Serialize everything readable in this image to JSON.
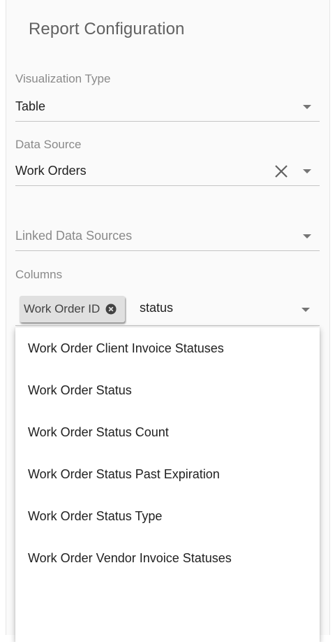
{
  "title": "Report Configuration",
  "visualization": {
    "label": "Visualization Type",
    "value": "Table"
  },
  "data_source": {
    "label": "Data Source",
    "value": "Work Orders"
  },
  "linked_sources": {
    "placeholder": "Linked Data Sources"
  },
  "columns": {
    "label": "Columns",
    "chips": [
      "Work Order ID"
    ],
    "search_value": "status"
  },
  "menu": {
    "items": [
      "Work Order Client Invoice Statuses",
      "Work Order Status",
      "Work Order Status Count",
      "Work Order Status Past Expiration",
      "Work Order Status Type",
      "Work Order Vendor Invoice Statuses"
    ]
  },
  "icons": {
    "dropdown": "caret-down-icon",
    "clear": "close-icon",
    "chip_remove": "cancel-circle-icon"
  },
  "colors": {
    "text_primary": "#212121",
    "text_secondary": "#8a8a8a",
    "chip_bg": "#e0e0e0"
  }
}
